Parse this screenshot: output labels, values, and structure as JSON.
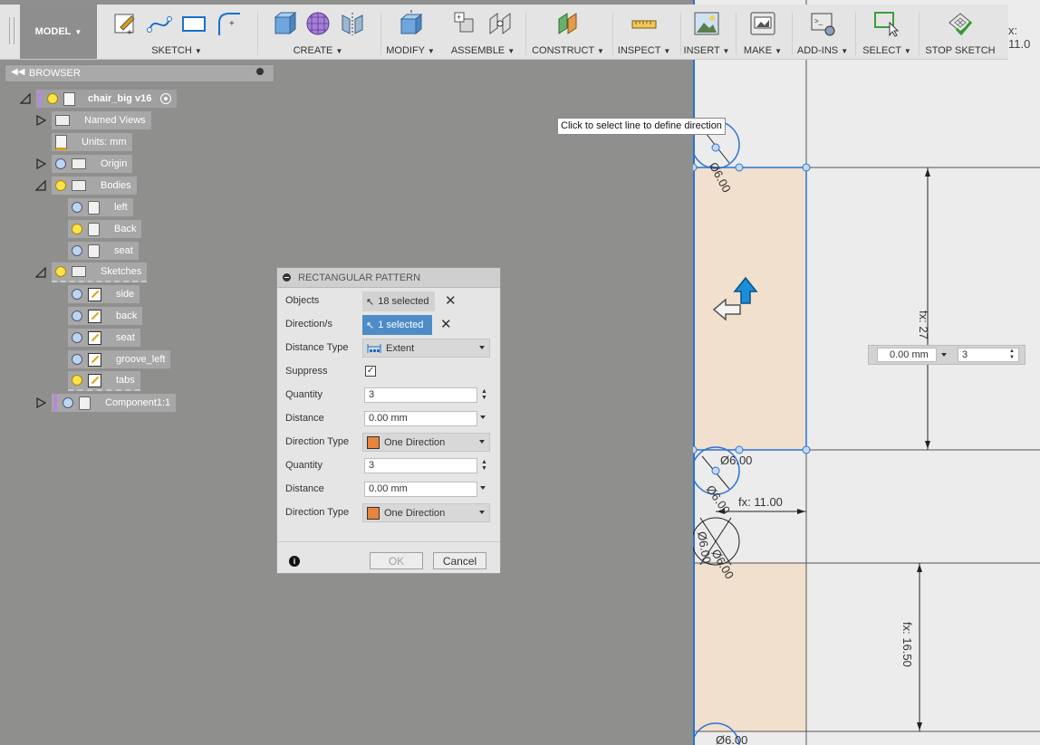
{
  "toolbar": {
    "model_label": "MODEL",
    "groups": [
      {
        "label": "SKETCH"
      },
      {
        "label": "CREATE"
      },
      {
        "label": "MODIFY"
      },
      {
        "label": "ASSEMBLE"
      },
      {
        "label": "CONSTRUCT"
      },
      {
        "label": "INSPECT"
      },
      {
        "label": "INSERT"
      },
      {
        "label": "MAKE"
      },
      {
        "label": "ADD-INS"
      },
      {
        "label": "SELECT"
      },
      {
        "label": "STOP SKETCH"
      }
    ],
    "coord_readout": "x: 11.0"
  },
  "browser": {
    "title": "BROWSER",
    "root": "chair_big v16",
    "items": [
      {
        "label": "Named Views"
      },
      {
        "label": "Units: mm"
      },
      {
        "label": "Origin"
      },
      {
        "label": "Bodies"
      },
      {
        "label": "left"
      },
      {
        "label": "Back"
      },
      {
        "label": "seat"
      },
      {
        "label": "Sketches"
      },
      {
        "label": "side"
      },
      {
        "label": "back"
      },
      {
        "label": "seat"
      },
      {
        "label": "groove_left"
      },
      {
        "label": "tabs"
      },
      {
        "label": "Component1:1"
      }
    ]
  },
  "dialog": {
    "title": "RECTANGULAR PATTERN",
    "objects_label": "Objects",
    "objects_value": "18 selected",
    "directions_label": "Direction/s",
    "directions_value": "1 selected",
    "distance_type_label": "Distance Type",
    "distance_type_value": "Extent",
    "suppress_label": "Suppress",
    "suppress_checked": true,
    "quantity_label": "Quantity",
    "quantity1": "3",
    "distance_label": "Distance",
    "distance1": "0.00 mm",
    "direction_type_label": "Direction Type",
    "direction_type1": "One Direction",
    "quantity2": "3",
    "distance2": "0.00 mm",
    "direction_type2": "One Direction",
    "ok_label": "OK",
    "cancel_label": "Cancel"
  },
  "canvas": {
    "tooltip": "Click to select line to define direction",
    "hud_distance": "0.00 mm",
    "hud_quantity": "3",
    "dims": {
      "d1": "Ø6.00",
      "d2": "Ø6.00",
      "d3": "Ø6.00",
      "d4": "Ø6.00",
      "d5": "Ø6.00",
      "d6": "Ø6.00",
      "fx1": "fx: 27",
      "fx2": "fx: 11.00",
      "fx3": "fx: 16.50"
    }
  },
  "colors": {
    "accent": "#4e8cc7",
    "face_fill": "#f1e0cd",
    "sketch_blue": "#2a73d6"
  }
}
